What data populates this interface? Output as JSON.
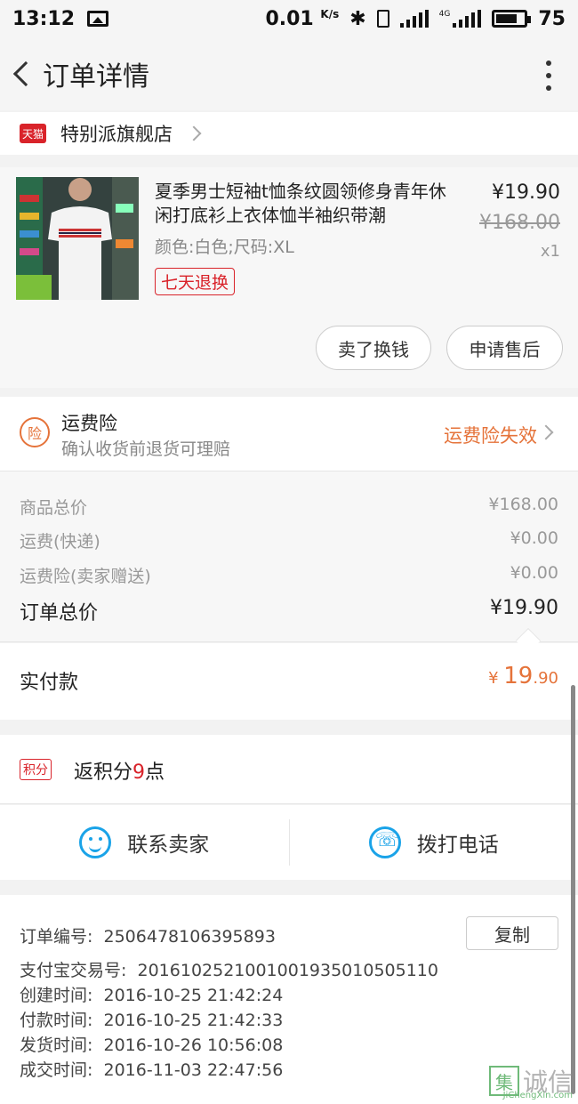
{
  "status_bar": {
    "time": "13:12",
    "speed": "0.01",
    "speed_unit": "K/s",
    "network": "4G",
    "battery": "75",
    "battery_level": 0.75
  },
  "nav": {
    "title": "订单详情"
  },
  "shop": {
    "badge": "天猫",
    "name": "特别派旗舰店"
  },
  "product": {
    "title": "夏季男士短袖t恤条纹圆领修身青年休闲打底衫上衣体恤半袖织带潮",
    "spec": "颜色:白色;尺码:XL",
    "tag": "七天退换",
    "price": "¥19.90",
    "original_price": "¥168.00",
    "quantity": "x1",
    "buttons": {
      "resell": "卖了换钱",
      "after_sale": "申请售后"
    }
  },
  "insurance": {
    "icon_text": "险",
    "title": "运费险",
    "subtitle": "确认收货前退货可理赔",
    "status": "运费险失效"
  },
  "totals": {
    "goods_label": "商品总价",
    "goods_value": "¥168.00",
    "shipping_label": "运费(快递)",
    "shipping_value": "¥0.00",
    "insurance_label": "运费险(卖家赠送)",
    "insurance_value": "¥0.00",
    "order_total_label": "订单总价",
    "order_total_value": "¥19.90"
  },
  "paid": {
    "label": "实付款",
    "currency": "¥",
    "integer": "19",
    "decimal": ".90"
  },
  "points": {
    "badge": "积分",
    "prefix": "返积分",
    "count": "9",
    "suffix": "点"
  },
  "contact": {
    "seller": "联系卖家",
    "phone": "拨打电话"
  },
  "order_info": {
    "order_no_label": "订单编号:",
    "order_no": "2506478106395893",
    "copy": "复制",
    "alipay_label": "支付宝交易号:",
    "alipay_no": "2016102521001001935010505110",
    "created_label": "创建时间:",
    "created": "2016-10-25 21:42:24",
    "paid_label": "付款时间:",
    "paid": "2016-10-25 21:42:33",
    "shipped_label": "发货时间:",
    "shipped": "2016-10-26 10:56:08",
    "closed_label": "成交时间:",
    "closed": "2016-11-03 22:47:56"
  },
  "watermark": {
    "box": "集",
    "text": "诚信",
    "sub": "JiChengXin.com"
  },
  "colors": {
    "accent_orange": "#e5733a",
    "tmall_red": "#d9232a",
    "contact_blue": "#1aa3e8"
  }
}
